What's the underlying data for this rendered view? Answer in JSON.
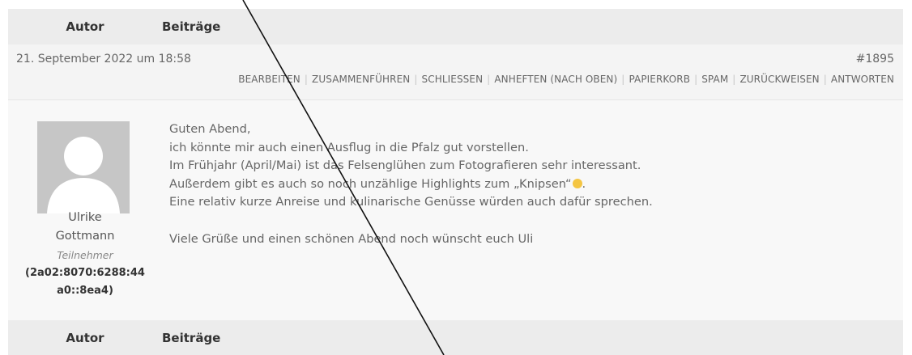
{
  "header": {
    "author_label": "Autor",
    "posts_label": "Beiträge"
  },
  "post": {
    "date": "21. September 2022 um 18:58",
    "id": "#1895",
    "actions": [
      "BEARBEITEN",
      "ZUSAMMENFÜHREN",
      "SCHLIESSEN",
      "ANHEFTEN (NACH OBEN)",
      "PAPIERKORB",
      "SPAM",
      "ZURÜCKWEISEN",
      "ANTWORTEN"
    ],
    "author": {
      "name_line1": "Ulrike",
      "name_line2": "Gottmann",
      "role": "Teilnehmer",
      "ip_line1": "(2a02:8070:6288:44",
      "ip_line2": "a0::8ea4)",
      "avatar_icon": "default-avatar-icon"
    },
    "lines": [
      "Guten Abend,",
      "ich könnte mir auch einen Ausflug in die Pfalz gut vorstellen.",
      "Im Frühjahr (April/Mai) ist das Felsenglühen zum Fotografieren sehr interessant.",
      "Außerdem gibt es auch so noch unzählige Highlights zum „Knipsen“",
      "Eine relativ kurze Anreise und kulinarische Genüsse würden auch dafür sprechen."
    ],
    "emoji_icon": "grinning-sweat-emoji-icon",
    "line4_end": ".",
    "closing": "Viele Grüße und einen schönen Abend noch wünscht euch Uli"
  },
  "footer": {
    "author_label": "Autor",
    "posts_label": "Beiträge"
  }
}
